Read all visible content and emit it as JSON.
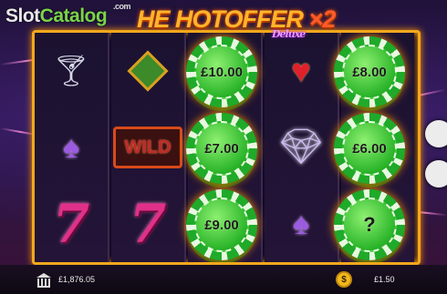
{
  "watermark": {
    "part1": "Slot",
    "part2": "Catalog",
    "suffix": ".com"
  },
  "game_title": {
    "main": "HOTOFFER",
    "cut_prefix": "HE",
    "multiplier": "×2",
    "subtitle": "Deluxe"
  },
  "reels": [
    [
      "martini-icon",
      "spade-icon",
      "seven-icon"
    ],
    [
      "diamond-suit-icon",
      "wild-icon",
      "seven-icon"
    ],
    [
      "chip",
      "chip",
      "chip"
    ],
    [
      "heart-icon",
      "gem-icon",
      "spade-icon"
    ],
    [
      "chip",
      "chip",
      "chip"
    ]
  ],
  "wild_label": "WILD",
  "seven_label": "7",
  "chips": {
    "r3c1": "£10.00",
    "r3c2": "£7.00",
    "r3c3": "£9.00",
    "r5c1": "£8.00",
    "r5c2": "£6.00",
    "r5c3": "?"
  },
  "bottom_bar": {
    "balance": "£1,876.05",
    "balance_icon": "bank-icon",
    "bet": "£1.50",
    "bet_icon": "coin-icon",
    "coin_symbol": "$"
  },
  "colors": {
    "frame": "#f2a81c",
    "chip_green": "#2bb52a",
    "watermark_green": "#7ad34a"
  }
}
